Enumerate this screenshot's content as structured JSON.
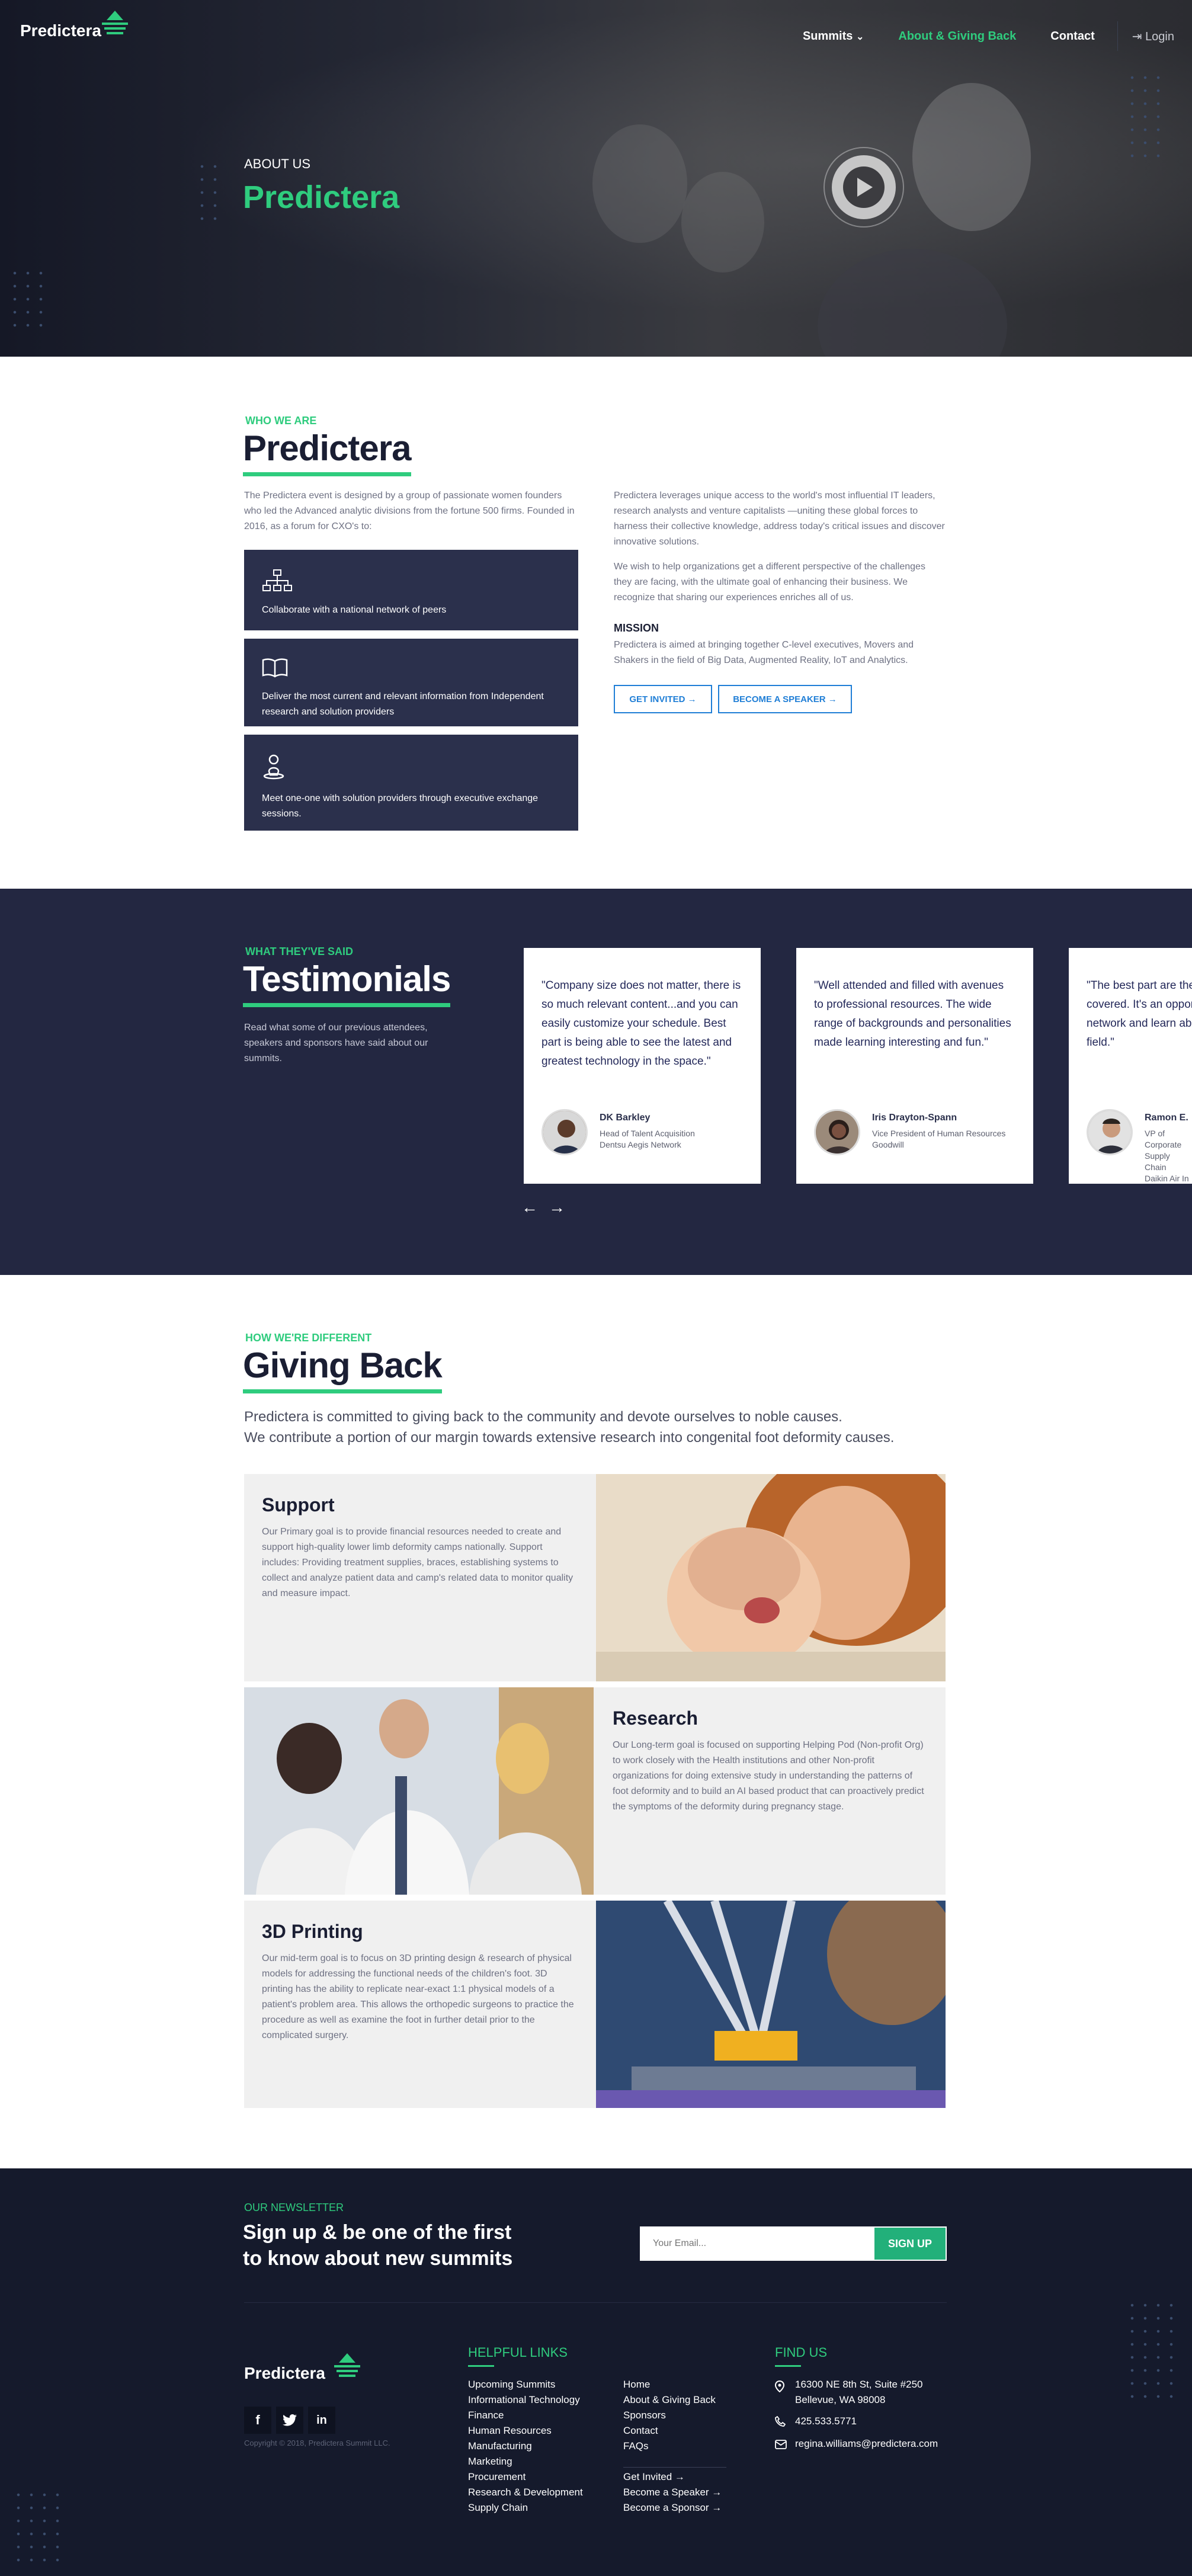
{
  "nav": {
    "logo": "Predictera",
    "items": [
      "Summits",
      "About & Giving Back",
      "Contact"
    ],
    "summits_caret": "⌄",
    "login": "Login"
  },
  "hero": {
    "subtitle": "ABOUT US",
    "title": "Predictera"
  },
  "about": {
    "eyebrow": "WHO WE ARE",
    "title": "Predictera",
    "intro": "The Predictera event is designed by a group of passionate women founders who led the Advanced analytic divisions from the fortune 500 firms. Founded in 2016, as a forum for CXO's to:",
    "features": [
      "Collaborate with a national network of peers",
      "Deliver the most current and relevant information from Independent research and solution providers",
      "Meet one-one with solution providers through executive exchange sessions."
    ],
    "p1": "Predictera leverages unique access to the world's most influential IT leaders, research analysts and venture capitalists —uniting these global forces to harness their collective knowledge, address today's critical issues and discover innovative solutions.",
    "p2": "We wish to help organizations get a different perspective of the challenges they are facing, with the ultimate goal of enhancing their business. We recognize that sharing our experiences enriches all of us.",
    "mission_h": "MISSION",
    "mission": "Predictera is aimed at bringing together C-level executives, Movers and Shakers in the field of Big Data, Augmented Reality, IoT and Analytics.",
    "btn1": "GET INVITED →",
    "btn2": "BECOME A SPEAKER →"
  },
  "testimonials": {
    "eyebrow": "WHAT THEY'VE SAID",
    "title": "Testimonials",
    "desc": "Read what some of our previous attendees, speakers and sponsors have said about our summits.",
    "cards": [
      {
        "quote": "\"Company size does not matter, there is so much relevant content...and you can easily customize your schedule. Best part is being able to see the latest and greatest technology in the space.\"",
        "name": "DK Barkley",
        "role": "Head of Talent Acquisition\nDentsu Aegis Network"
      },
      {
        "quote": "\"Well attended and filled with avenues to professional resources. The wide range of backgrounds and personalities made learning interesting and fun.\"",
        "name": "Iris Drayton-Spann",
        "role": "Vice President of Human Resources\nGoodwill"
      },
      {
        "quote": "\"The best part are the topics and topics covered. It's an opportunity to hear from network and learn about solutions in the field.\"",
        "name": "Ramon E.",
        "role": "VP of Corporate\nSupply Chain\nDaikin Air In"
      }
    ],
    "prev": "←",
    "next": "→"
  },
  "giving": {
    "eyebrow": "HOW WE'RE DIFFERENT",
    "title": "Giving Back",
    "lead1": "Predictera is committed to giving back to the community and devote ourselves to noble causes.",
    "lead2": "We contribute a portion of our margin towards extensive research into congenital foot deformity causes.",
    "rows": [
      {
        "title": "Support",
        "text": "Our Primary goal is to provide financial resources needed to create and support high-quality lower limb deformity camps nationally. Support includes: Providing treatment supplies, braces, establishing systems to collect and analyze patient data and camp's related data to monitor quality and measure impact."
      },
      {
        "title": "Research",
        "text": "Our Long-term goal is focused on supporting Helping Pod (Non-profit Org) to work closely with the Health institutions and other Non-profit organizations for doing extensive study in understanding the patterns of foot deformity and to build an AI based product that can proactively predict the symptoms of the deformity during pregnancy stage."
      },
      {
        "title": "3D Printing",
        "text": "Our mid-term goal is to focus on 3D printing design & research of physical models for addressing the functional needs of the children's foot. 3D printing has the ability to replicate near-exact 1:1 physical models of a patient's problem area. This allows the orthopedic surgeons to practice the procedure as well as examine the foot in further detail prior to the complicated surgery."
      }
    ]
  },
  "newsletter": {
    "eyebrow": "OUR NEWSLETTER",
    "line1": "Sign up & be one of the first",
    "line2": "to know about new summits",
    "placeholder": "Your Email...",
    "btn": "SIGN UP"
  },
  "footer": {
    "logo": "Predictera",
    "copyright": "Copyright © 2018, Predictera Summit LLC.",
    "helpful": "HELPFUL LINKS",
    "col1": [
      "Upcoming Summits",
      "Informational Technology",
      "Finance",
      "Human Resources",
      "Manufacturing",
      "Marketing",
      "Procurement",
      "Research & Development",
      "Supply Chain"
    ],
    "col2": [
      "Home",
      "About & Giving Back",
      "Sponsors",
      "Contact",
      "FAQs"
    ],
    "col2b": [
      "Get Invited →",
      "Become a Speaker →",
      "Become a Sponsor →"
    ],
    "find": "FIND US",
    "addr1": "16300 NE 8th St, Suite #250",
    "addr2": "Bellevue, WA 98008",
    "phone": "425.533.5771",
    "email": "regina.williams@predictera.com"
  }
}
